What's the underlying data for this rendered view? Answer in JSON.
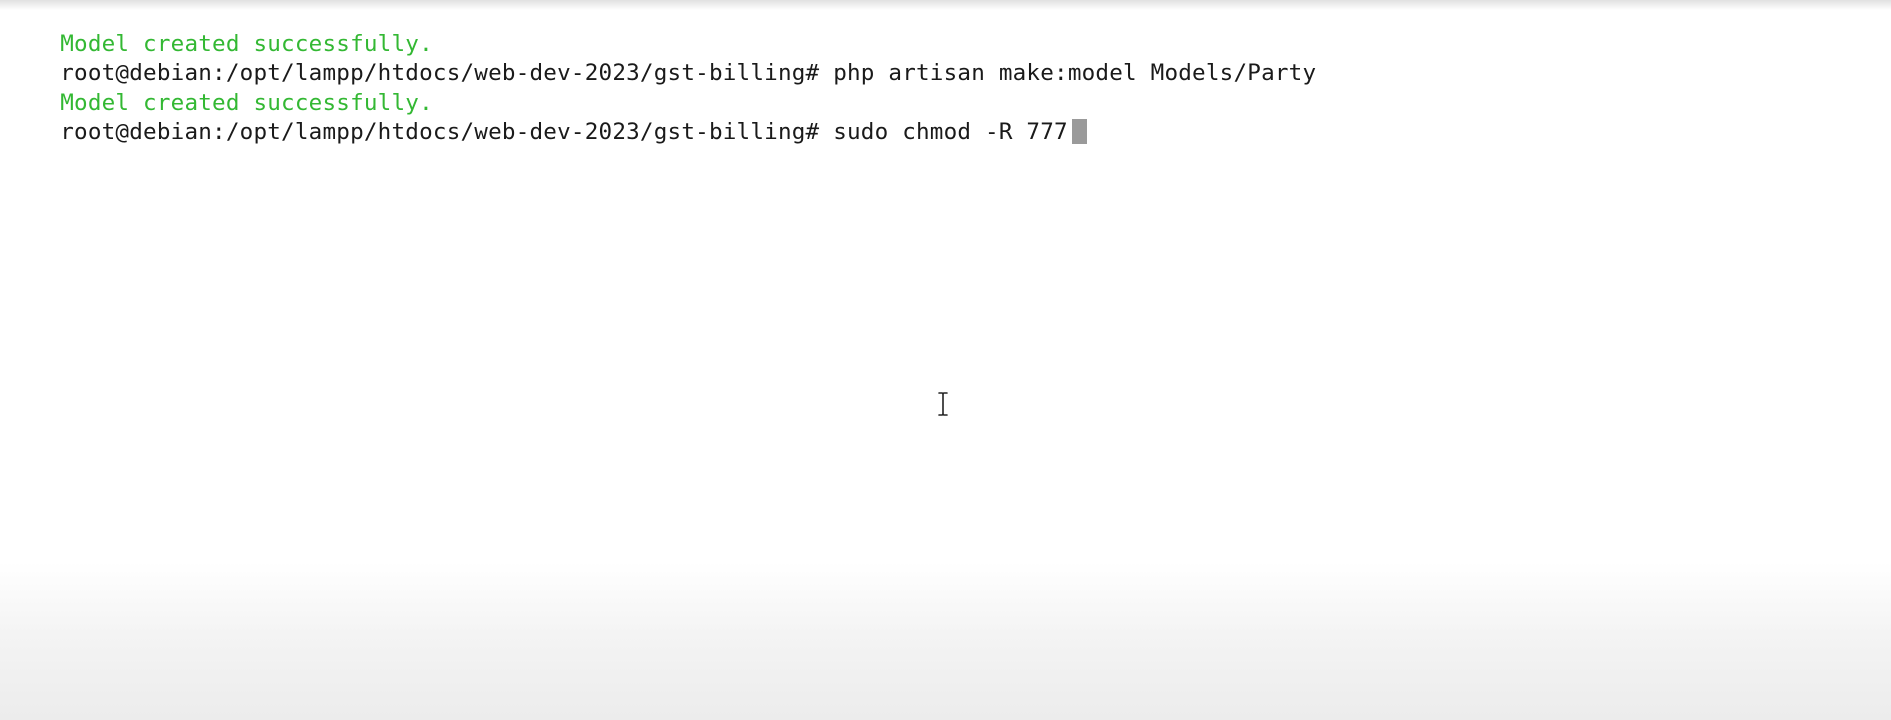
{
  "terminal": {
    "lines": [
      {
        "kind": "output",
        "text": "Model created successfully."
      },
      {
        "kind": "prompt",
        "prompt": "root@debian:/opt/lampp/htdocs/web-dev-2023/gst-billing#",
        "command": "php artisan make:model Models/Party"
      },
      {
        "kind": "output",
        "text": "Model created successfully."
      },
      {
        "kind": "prompt",
        "prompt": "root@debian:/opt/lampp/htdocs/web-dev-2023/gst-billing#",
        "command": "sudo chmod -R 777"
      }
    ]
  },
  "colors": {
    "success": "#33b833",
    "text": "#1a1a1a",
    "cursor": "#9a9a9a",
    "background": "#ffffff"
  },
  "icons": {
    "pointer": "text-cursor-ibeam-icon"
  }
}
